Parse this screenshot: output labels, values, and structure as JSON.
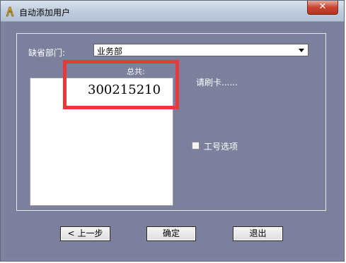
{
  "window": {
    "title": "自动添加用户",
    "close_label": "✕"
  },
  "form": {
    "dept_label": "缺省部门:",
    "dept_value": "业务部",
    "total_label": "总共:",
    "count_value": "300215210",
    "swipe_prompt": "请刷卡......",
    "employee_option_label": "工号选项",
    "employee_option_checked": false
  },
  "buttons": {
    "prev_label": "上一步",
    "ok_label": "确定",
    "exit_label": "退出"
  },
  "colors": {
    "dialog_bg": "#7f839f",
    "highlight": "#e8383a"
  },
  "icons": {
    "app": "app-icon",
    "dropdown": "chevron-down-icon",
    "prev": "chevron-left-icon"
  }
}
